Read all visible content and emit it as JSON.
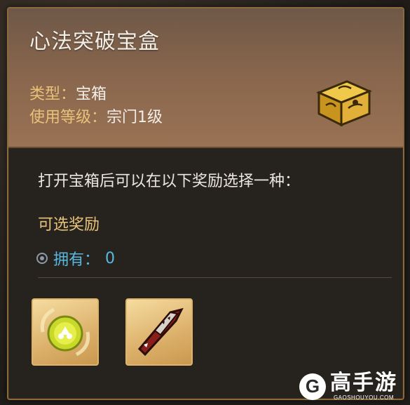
{
  "item": {
    "title": "心法突破宝盒",
    "type_label": "类型：",
    "type_value": "宝箱",
    "level_label": "使用等级：",
    "level_value": "宗门1级",
    "icon": "golden-chest-icon"
  },
  "description": "打开宝箱后可以在以下奖励选择一种：",
  "optional_rewards_label": "可选奖励",
  "owned": {
    "label": "拥有：",
    "value": "0"
  },
  "rewards": [
    {
      "icon": "golden-orb-icon"
    },
    {
      "icon": "red-blade-icon"
    }
  ],
  "watermark": {
    "cn": "高手游",
    "en": "GAOSHOUYOU.COM",
    "logo": "G"
  },
  "colors": {
    "header_gold": "#e9c27a",
    "owned_blue": "#59b8e0",
    "border": "#8a6a3e"
  }
}
